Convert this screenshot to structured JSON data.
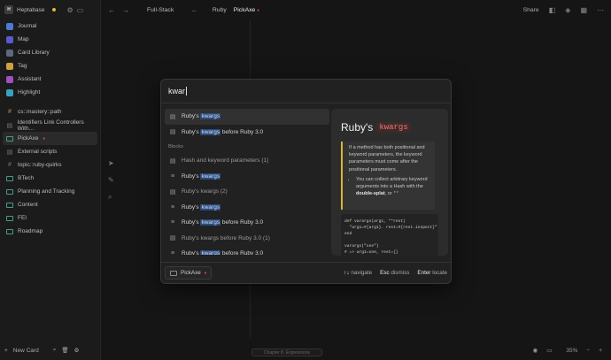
{
  "workspace": {
    "initials": "H",
    "name": "Heptabase"
  },
  "sidebar": {
    "nav": [
      {
        "label": "Journal",
        "color": "#4a7bd0"
      },
      {
        "label": "Map",
        "color": "#5a5ad0"
      },
      {
        "label": "Card Library",
        "color": "#5a6a80"
      },
      {
        "label": "Tag",
        "color": "#d0a040"
      },
      {
        "label": "Assistant",
        "color": "#a050c0"
      },
      {
        "label": "Highlight",
        "color": "#3aa0c0"
      }
    ],
    "tags": [
      {
        "label": "cs::mastery::path",
        "kind": "hash-orange"
      },
      {
        "label": "Identifiers Link Controllers With...",
        "kind": "doc"
      },
      {
        "label": "PickAxe",
        "kind": "card-teal",
        "active": true,
        "flame": "♦"
      },
      {
        "label": "External scripts",
        "kind": "doc"
      },
      {
        "label": "topic::ruby-quirks",
        "kind": "hash"
      },
      {
        "label": "BTech",
        "kind": "card-teal"
      },
      {
        "label": "Planning and Tracking",
        "kind": "card-teal"
      },
      {
        "label": "Content",
        "kind": "card-teal"
      },
      {
        "label": "FEI",
        "kind": "card-teal"
      },
      {
        "label": "Roadmap",
        "kind": "card-teal"
      }
    ],
    "new_card": "New Card"
  },
  "topbar": {
    "breadcrumbs": [
      "Full-Stack",
      "...",
      "Ruby",
      "PickAxe"
    ],
    "share": "Share"
  },
  "search": {
    "query": "kwar"
  },
  "results": {
    "top": [
      {
        "pre": "Ruby's ",
        "hl": "kwargs",
        "post": "",
        "icon": "doc",
        "selected": true
      },
      {
        "pre": "Ruby's ",
        "hl": "kwargs",
        "post": " before Ruby 3.0",
        "icon": "doc"
      }
    ],
    "blocks_label": "Blocks",
    "blocks": [
      {
        "pre": "Hash and keyword parameters (1)",
        "hl": "",
        "post": "",
        "icon": "doc",
        "dim": true
      },
      {
        "pre": "Ruby's ",
        "hl": "kwargs",
        "post": "",
        "icon": "lines"
      },
      {
        "pre": "Ruby's kwargs (2)",
        "hl": "",
        "post": "",
        "icon": "doc",
        "dim": true
      },
      {
        "pre": "Ruby's ",
        "hl": "kwargs",
        "post": "",
        "icon": "lines"
      },
      {
        "pre": "Ruby's ",
        "hl": "kwargs",
        "post": " before Ruby 3.0",
        "icon": "lines"
      },
      {
        "pre": "Ruby's kwargs before Ruby 3.0 (1)",
        "hl": "",
        "post": "",
        "icon": "doc",
        "dim": true
      },
      {
        "pre": "Ruby's ",
        "hl": "kwargs",
        "post": " before Ruby 3.0",
        "icon": "lines"
      }
    ]
  },
  "preview": {
    "title": "Ruby's",
    "keyword": "kwargs",
    "callout": "If a method has both positional and keyword parameters, the keyword parameters must come after the positional parameters.",
    "bullet_pre": "You can collect arbitrary keyword arguments into a Hash with the ",
    "bullet_bold": "double-splat",
    "bullet_mid": ", or ",
    "bullet_code": "**",
    "code_lines": [
      "def varargs(arg1, **rest)",
      "  \"arg1=#{arg1}. rest=#{rest.inspect}\"",
      "end",
      "",
      "varargs(\"one\")",
      "# => arg1=one, rest={}"
    ]
  },
  "footer": {
    "chip": "PickAxe",
    "navigate_key": "↑↓",
    "navigate": "navigate",
    "dismiss_key": "Esc",
    "dismiss": "dismiss",
    "locate_key": "Enter",
    "locate": "locate"
  },
  "bottombar": {
    "chapter": "Chapter 8. Expressions",
    "zoom": "35%"
  }
}
